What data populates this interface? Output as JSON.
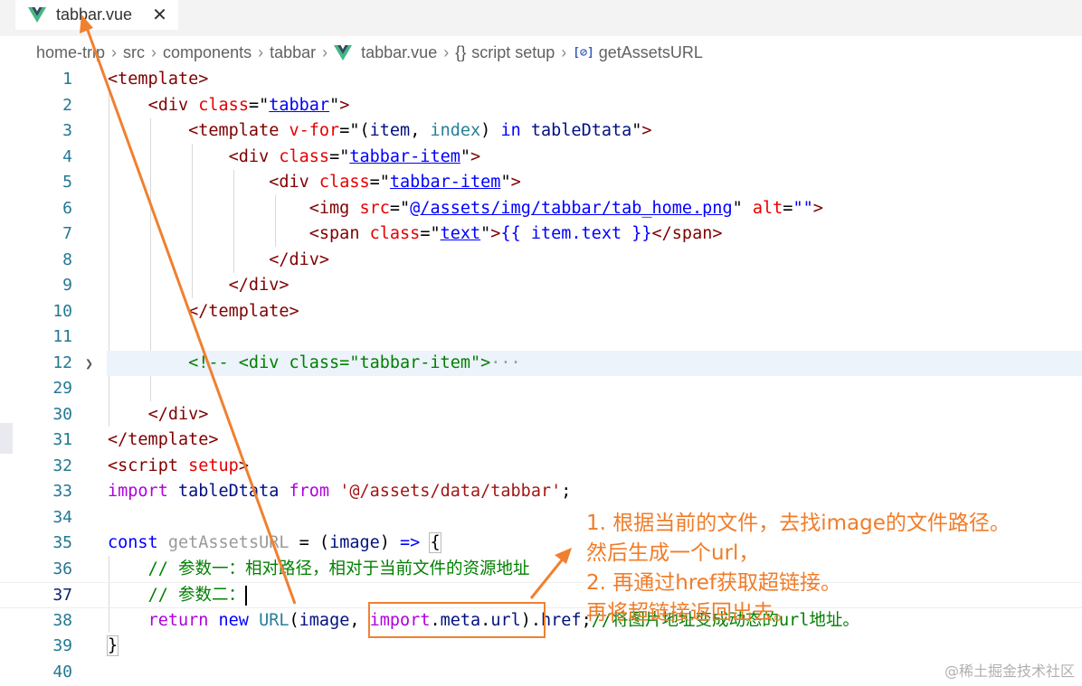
{
  "tab": {
    "filename": "tabbar.vue",
    "close": "✕"
  },
  "breadcrumb": {
    "items": [
      "home-trip",
      "src",
      "components",
      "tabbar",
      "tabbar.vue",
      "script setup",
      "getAssetsURL"
    ],
    "braces": "{}",
    "method_icon": "[⊘]"
  },
  "code": {
    "line_numbers": [
      "1",
      "2",
      "3",
      "4",
      "5",
      "6",
      "7",
      "8",
      "9",
      "10",
      "11",
      "12",
      "29",
      "30",
      "31",
      "32",
      "33",
      "34",
      "35",
      "36",
      "37",
      "38",
      "39",
      "40"
    ],
    "l1": "<template>",
    "l2_open": "<div",
    "l2_attr": "class",
    "l2_val": "tabbar",
    "l3_open": "<template",
    "l3_attr": "v-for",
    "l3_item": "item",
    "l3_index": "index",
    "l3_in": "in",
    "l3_data": "tableDtata",
    "l4_val": "tabbar-item",
    "l5_val": "tabbar-item",
    "l6_tag": "<img",
    "l6_src": "src",
    "l6_path": "@/assets/img/tabbar/tab_home.png",
    "l6_alt": "alt",
    "l7_tag": "<span",
    "l7_attr": "class",
    "l7_val": "text",
    "l7_expr": "{{ item.text }}",
    "l7_close": "</span>",
    "l8": "</div>",
    "l9": "</div>",
    "l10": "</template>",
    "l12": "<!-- <div class=\"tabbar-item\">",
    "l12_ellipsis": "···",
    "l30": "</div>",
    "l31": "</template>",
    "l32_tag": "<script",
    "l32_attr": "setup",
    "l33_import": "import",
    "l33_name": "tableDtata",
    "l33_from": "from",
    "l33_path": "'@/assets/data/tabbar'",
    "l35_const": "const",
    "l35_name": "getAssetsURL",
    "l35_param": "image",
    "l36": "// 参数一：相对路径，相对于当前文件的资源地址",
    "l37": "// 参数二：",
    "l38_return": "return",
    "l38_new": "new",
    "l38_cls": "URL",
    "l38_image": "image",
    "l38_import": "import",
    "l38_meta": "meta",
    "l38_url": "url",
    "l38_href": "href",
    "l38_cmt": "//将图片地址变成动态的url地址。"
  },
  "annotation": {
    "lines": [
      "1. 根据当前的文件，去找image的文件路径。",
      "然后生成一个url，",
      "2. 再通过href获取超链接。",
      "再将超链接返回出去。"
    ],
    "color": "#f07c28"
  },
  "watermark": "@稀土掘金技术社区"
}
